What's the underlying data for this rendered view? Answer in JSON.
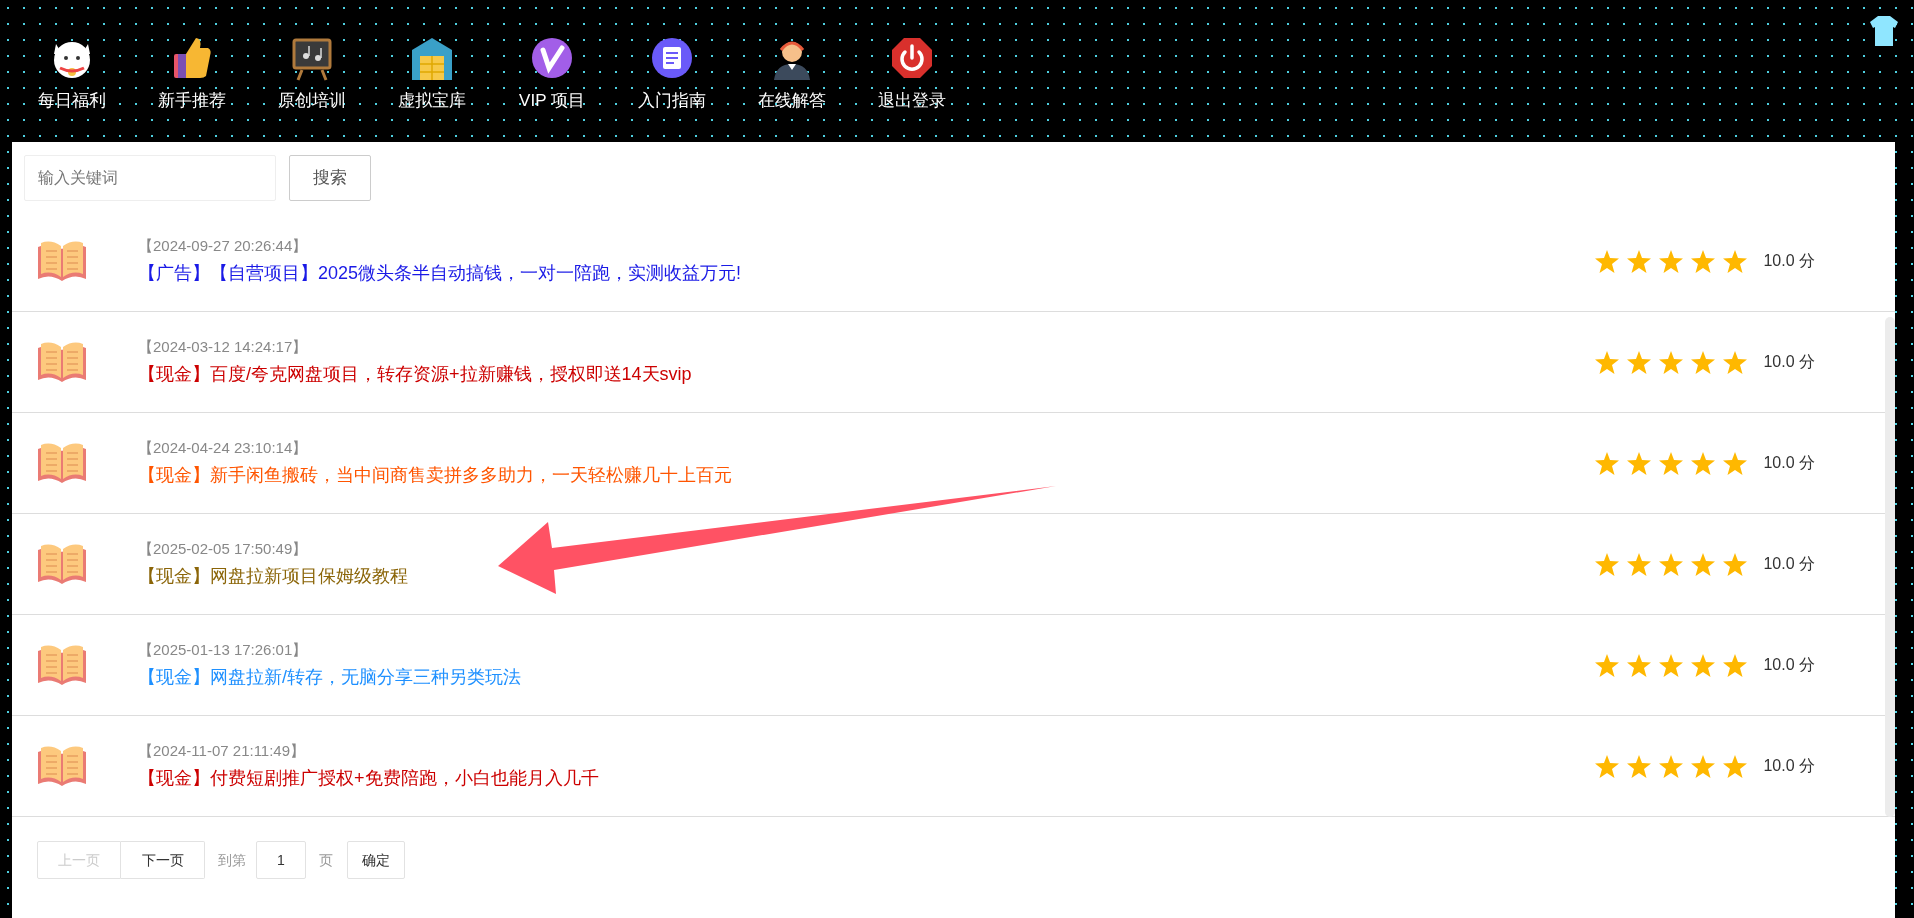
{
  "nav": [
    {
      "label": "每日福利"
    },
    {
      "label": "新手推荐"
    },
    {
      "label": "原创培训"
    },
    {
      "label": "虚拟宝库"
    },
    {
      "label": "VIP 项目"
    },
    {
      "label": "入门指南"
    },
    {
      "label": "在线解答"
    },
    {
      "label": "退出登录"
    }
  ],
  "search": {
    "placeholder": "输入关键词",
    "button": "搜索"
  },
  "articles": [
    {
      "date": "【2024-09-27 20:26:44】",
      "title": "【广告】【自营项目】2025微头条半自动搞钱，一对一陪跑，实测收益万元!",
      "color": "#1a1ae6",
      "stars": 5,
      "score": "10.0 分"
    },
    {
      "date": "【2024-03-12 14:24:17】",
      "title": "【现金】百度/夸克网盘项目，转存资源+拉新赚钱，授权即送14天svip",
      "color": "#cc0000",
      "stars": 5,
      "score": "10.0 分"
    },
    {
      "date": "【2024-04-24 23:10:14】",
      "title": "【现金】新手闲鱼搬砖，当中间商售卖拼多多助力，一天轻松赚几十上百元",
      "color": "#ff5500",
      "stars": 5,
      "score": "10.0 分"
    },
    {
      "date": "【2025-02-05 17:50:49】",
      "title": "【现金】网盘拉新项目保姆级教程",
      "color": "#8b6508",
      "stars": 5,
      "score": "10.0 分"
    },
    {
      "date": "【2025-01-13 17:26:01】",
      "title": "【现金】网盘拉新/转存，无脑分享三种另类玩法",
      "color": "#1e90ff",
      "stars": 5,
      "score": "10.0 分"
    },
    {
      "date": "【2024-11-07 21:11:49】",
      "title": "【现金】付费短剧推广授权+免费陪跑，小白也能月入几千",
      "color": "#cc0000",
      "stars": 5,
      "score": "10.0 分"
    }
  ],
  "pagination": {
    "prev": {
      "label": "上一页",
      "disabled": true
    },
    "next": {
      "label": "下一页",
      "disabled": false
    },
    "goto_label": "到第",
    "page": "1",
    "page_suffix": "页",
    "confirm": "确定"
  }
}
